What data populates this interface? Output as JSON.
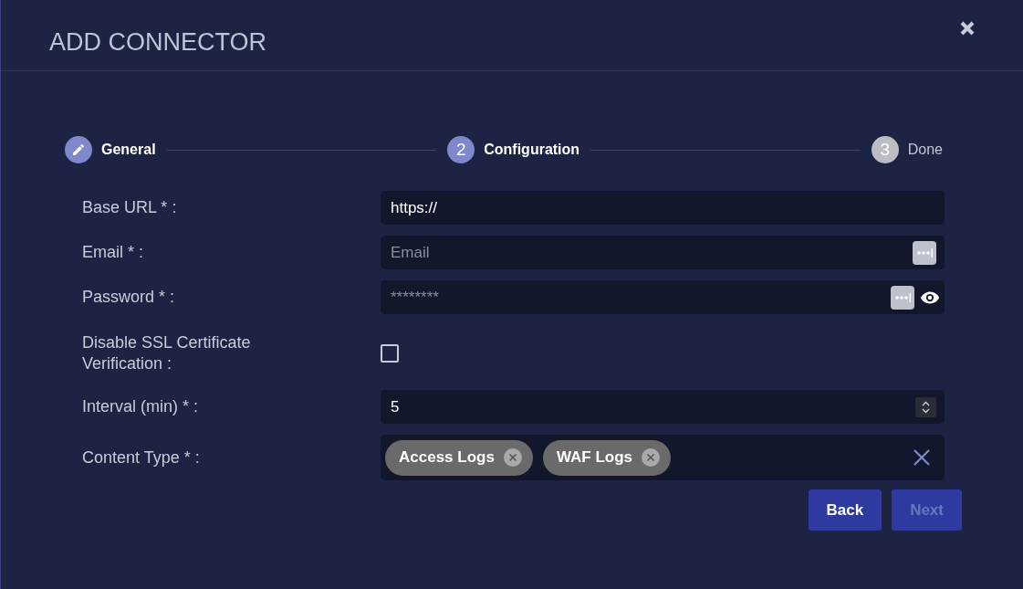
{
  "dialog": {
    "title": "ADD CONNECTOR"
  },
  "steps": [
    {
      "label": "General",
      "completed": true,
      "selected": false
    },
    {
      "label": "Configuration",
      "number": "2",
      "completed": false,
      "selected": true
    },
    {
      "label": "Done",
      "number": "3",
      "completed": false,
      "selected": false
    }
  ],
  "fields": [
    {
      "label": "Base URL * :",
      "kind": "text",
      "value": "https://"
    },
    {
      "label": "Email * :",
      "kind": "text",
      "placeholder": "Email",
      "autofill": true
    },
    {
      "label": "Password * :",
      "kind": "password",
      "placeholder": "********",
      "autofill": true
    },
    {
      "label": "Disable SSL Certificate Verification  :",
      "kind": "checkbox",
      "checked": false
    },
    {
      "label": "Interval (min) * :",
      "kind": "number",
      "value": "5"
    },
    {
      "label": "Content Type * :",
      "kind": "tags",
      "tags": [
        "Access Logs",
        "WAF Logs"
      ]
    }
  ],
  "buttons": [
    {
      "label": "Back",
      "disabled": false
    },
    {
      "label": "Next",
      "disabled": true
    }
  ]
}
